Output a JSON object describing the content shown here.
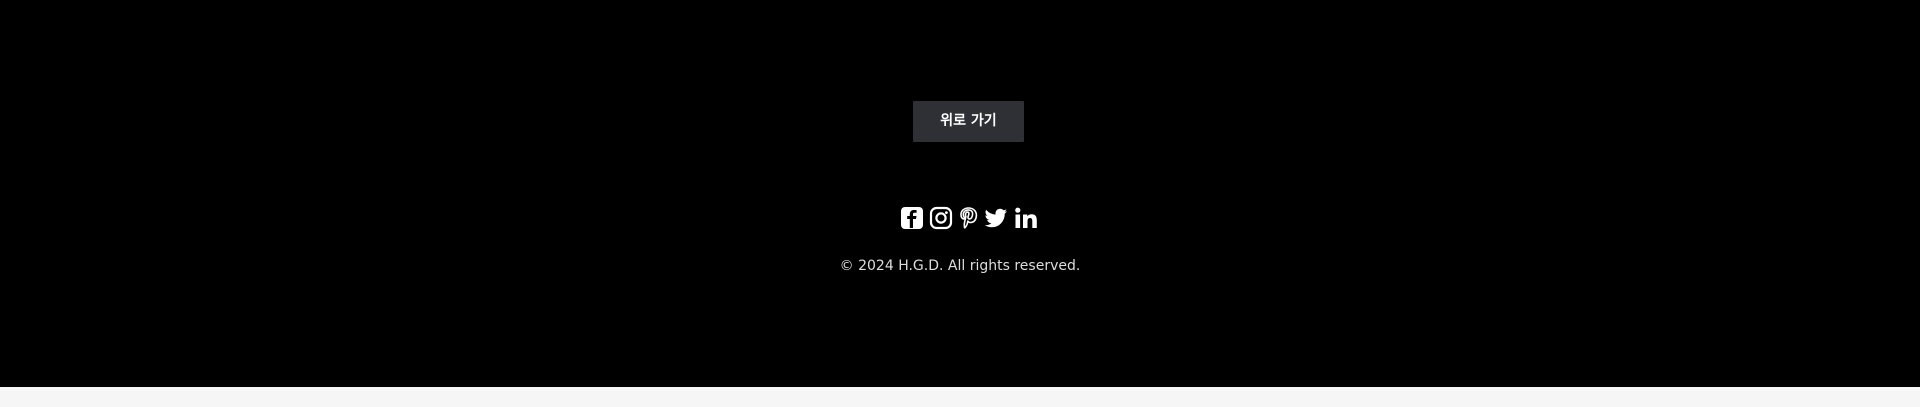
{
  "footer": {
    "top_button_label": "위로 가기",
    "social": [
      {
        "icon": "facebook-icon"
      },
      {
        "icon": "instagram-icon"
      },
      {
        "icon": "pinterest-icon"
      },
      {
        "icon": "twitter-icon"
      },
      {
        "icon": "linkedin-icon"
      }
    ],
    "copyright": "© 2024 H.G.D. All rights reserved."
  },
  "colors": {
    "footer_bg": "#000000",
    "button_bg": "#2f3035",
    "text": "#dddddd",
    "page_bg": "#f6f6f6"
  }
}
